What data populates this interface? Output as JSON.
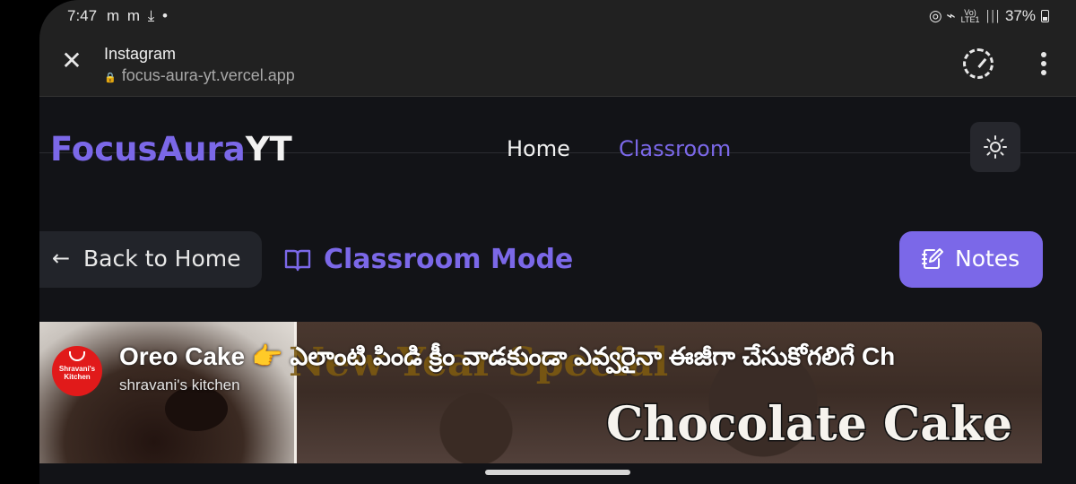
{
  "status_bar": {
    "time": "7:47",
    "left_icons": "m m ⤓ •",
    "right_icons": "◎ ⌁",
    "network_label": "Vo)\nLTE1",
    "signal": "│││",
    "battery": "37%"
  },
  "tab_bar": {
    "title": "Instagram",
    "url": "focus-aura-yt.vercel.app",
    "lock_icon": "🔒",
    "close_icon": "✕"
  },
  "site": {
    "brand_part1": "FocusAura",
    "brand_part2": "YT",
    "nav": {
      "home": "Home",
      "classroom": "Classroom"
    }
  },
  "toolbar": {
    "back_arrow": "←",
    "back_label": "Back to Home",
    "mode_label": "Classroom Mode",
    "notes_label": "Notes"
  },
  "video": {
    "title": "Oreo Cake 👉 ఎలాంటి పిండి క్రీం వాడకుండా ఎవ్వరైనా ఈజీగా చేసుకోగలిగే Ch",
    "channel": "shravani's kitchen",
    "channel_logo_text": "Shravani's Kitchen",
    "thumb_text_1": "New Year Special",
    "thumb_text_2": "Chocolate Cake"
  },
  "colors": {
    "accent": "#7b68e8",
    "background": "#121317",
    "chrome": "#212121",
    "channel_logo": "#e11a1a"
  }
}
